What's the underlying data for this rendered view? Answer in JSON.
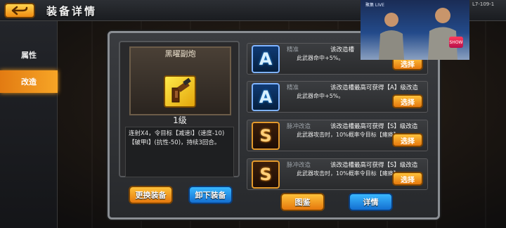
{
  "header": {
    "title": "装备详情"
  },
  "sidebar": {
    "tabs": [
      {
        "label": "属性"
      },
      {
        "label": "改造"
      }
    ]
  },
  "weapon": {
    "name": "黑曜副炮",
    "level": "1级",
    "description": "连射X4，令目标【减速Ⅰ】(速度-10)【破甲Ⅰ】(抗性-50)，持续3回合。"
  },
  "buttons": {
    "replace": "更换装备",
    "unequip": "卸下装备",
    "gallery": "图鉴",
    "details": "详情"
  },
  "mods": [
    {
      "grade": "A",
      "title": "精准",
      "slot_text": "该改造槽",
      "desc": "此武器命中+5%。",
      "pick": "选择"
    },
    {
      "grade": "A",
      "title": "精准",
      "slot_text": "该改造槽最高可获得【A】级改造",
      "desc": "此武器命中+5%。",
      "pick": "选择"
    },
    {
      "grade": "S",
      "title": "脉冲改造",
      "slot_text": "该改造槽最高可获得【S】级改造",
      "desc": "此武器攻击时，10%概率令目标【瘫痪】。",
      "pick": "选择"
    },
    {
      "grade": "S",
      "title": "脉冲改造",
      "slot_text": "该改造槽最高可获得【S】级改造",
      "desc": "此武器攻击时，10%概率令目标【瘫痪】。",
      "pick": "选择"
    }
  ],
  "camera": {
    "tag": "聚集 LIVE",
    "id": "L7-109-1",
    "badge": "SHOW"
  }
}
